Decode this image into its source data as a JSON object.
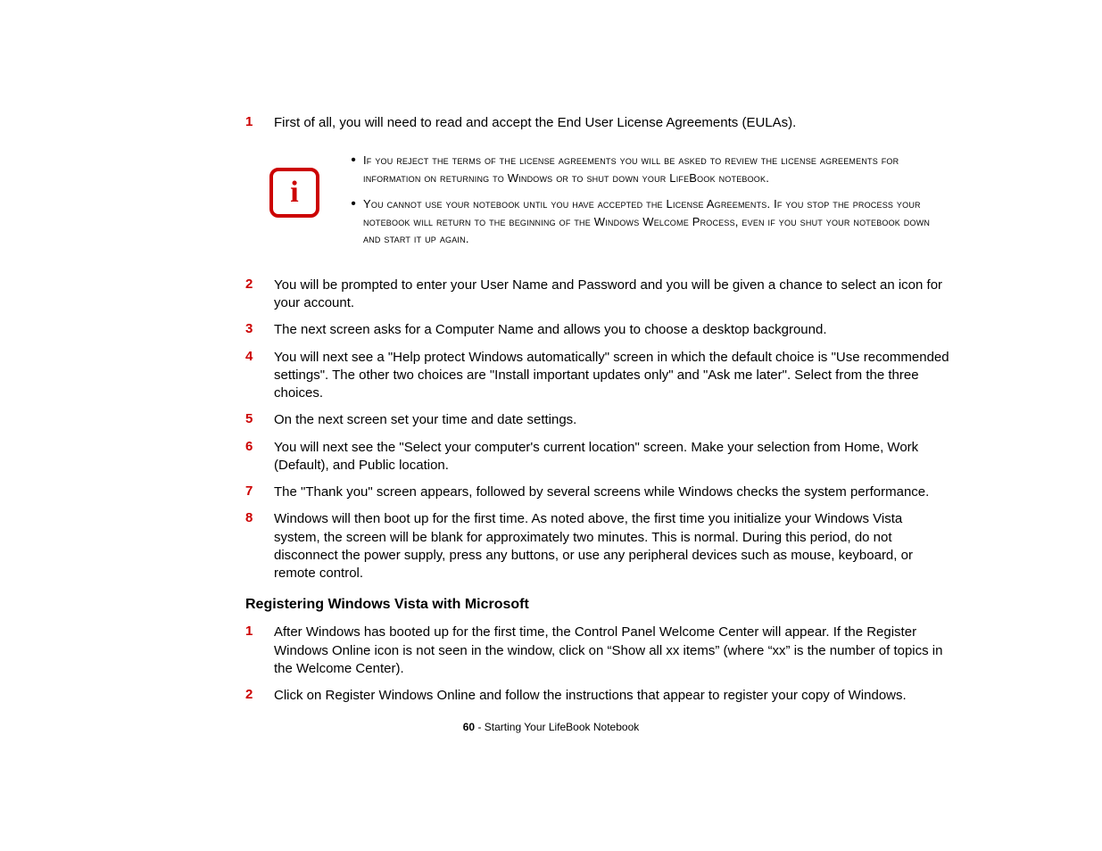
{
  "list1": {
    "item1": {
      "num": "1",
      "text": "First of all, you will need to read and accept the End User License Agreements (EULAs)."
    }
  },
  "info": {
    "bullet1": "If you reject the terms of the license agreements you will be asked to review the license agreements for information on returning to Windows or to shut down your LifeBook notebook.",
    "bullet2": "You cannot use your notebook until you have accepted the License Agreements. If you stop the process your notebook will return to the beginning of the Windows Welcome Process, even if you shut your notebook down and start it up again."
  },
  "list2": {
    "item2": {
      "num": "2",
      "text": "You will be prompted to enter your User Name and Password and you will be given a chance to select an icon for your account."
    },
    "item3": {
      "num": "3",
      "text": "The next screen asks for a Computer Name and allows you to choose a desktop background."
    },
    "item4": {
      "num": "4",
      "text": "You will next see a \"Help protect Windows automatically\" screen in which the default choice is \"Use recommended settings\". The other two choices are \"Install important updates only\" and \"Ask me later\". Select from the three choices."
    },
    "item5": {
      "num": "5",
      "text": "On the next screen set your time and date settings."
    },
    "item6": {
      "num": "6",
      "text": "You will next see the \"Select your computer's current location\" screen. Make your selection from Home, Work (Default), and Public location."
    },
    "item7": {
      "num": "7",
      "text": "The \"Thank you\" screen appears, followed by several screens while Windows checks the system performance."
    },
    "item8": {
      "num": "8",
      "text": "Windows will then boot up for the first time. As noted above, the first time you initialize your Windows Vista system, the screen will be blank for approximately two minutes. This is normal. During this period, do not disconnect the power supply, press any buttons, or use any peripheral devices such as mouse, keyboard, or remote control."
    }
  },
  "heading": "Registering Windows Vista with Microsoft",
  "list3": {
    "item1": {
      "num": "1",
      "text": "After Windows has booted up for the first time, the Control Panel Welcome Center will appear. If the Register Windows Online icon is not seen in the window, click on “Show all xx items” (where “xx” is the number of topics in the Welcome Center)."
    },
    "item2": {
      "num": "2",
      "text": "Click on Register Windows Online and follow the instructions that appear to register your copy of Windows."
    }
  },
  "footer": {
    "page": "60",
    "sep": " - ",
    "title": "Starting Your LifeBook Notebook"
  }
}
